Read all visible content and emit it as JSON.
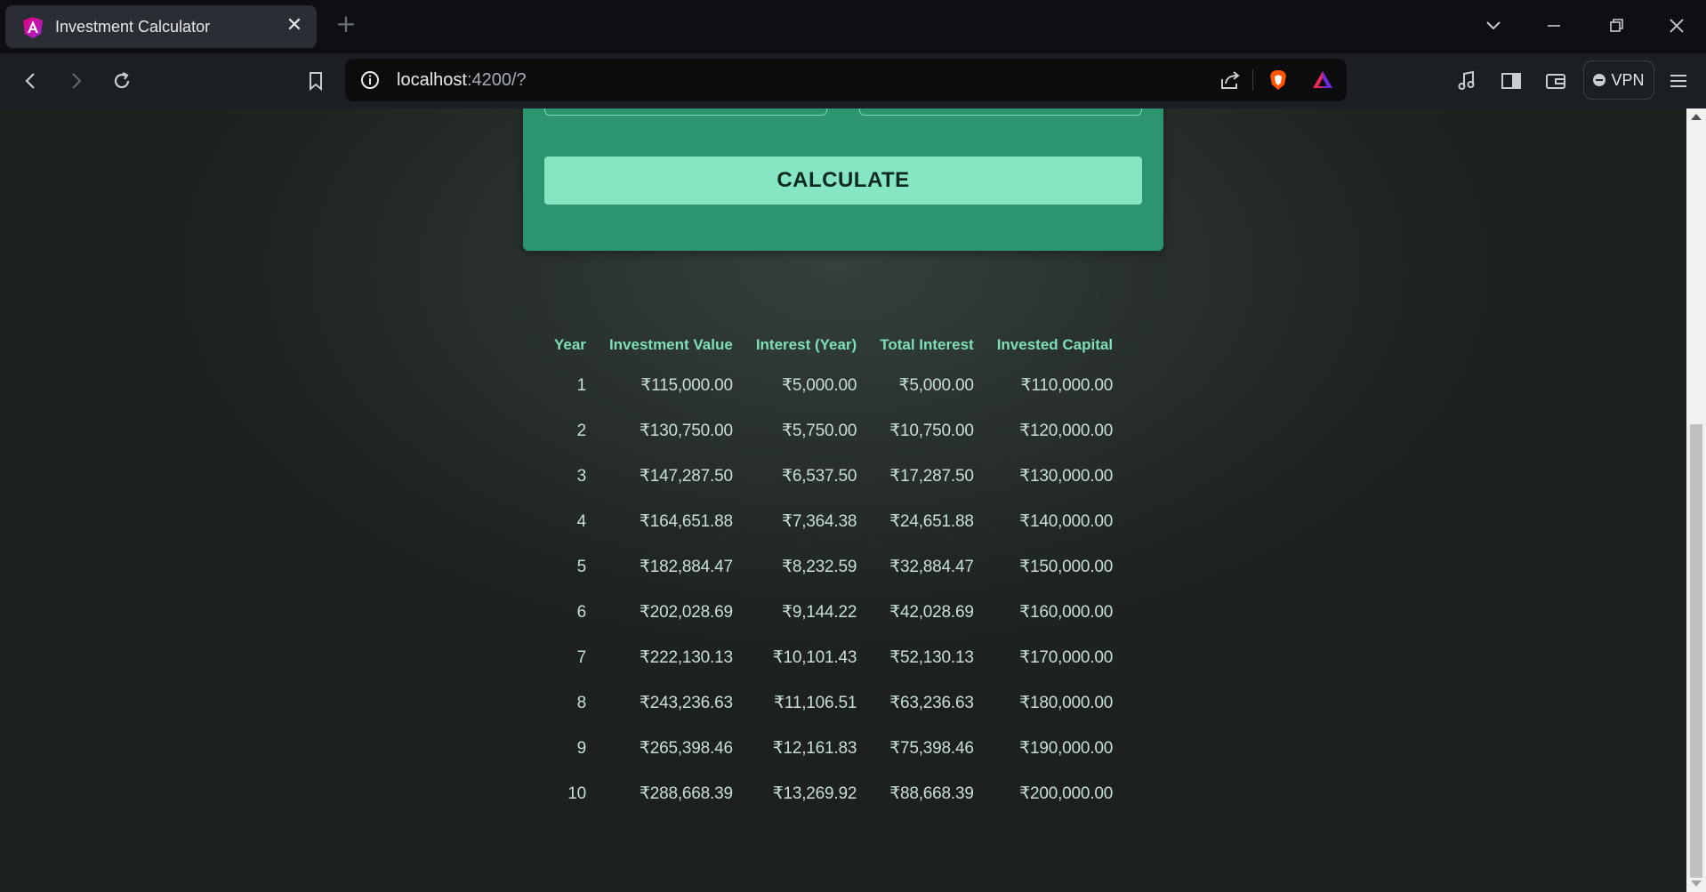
{
  "browser": {
    "tab": {
      "title": "Investment Calculator",
      "close_glyph": "✕"
    },
    "new_tab_glyph": "+",
    "window_controls": {
      "tabs_menu": "⌄",
      "minimize": "—",
      "restore": "❐",
      "close": "✕"
    },
    "toolbar": {
      "back": "‹",
      "forward": "›",
      "reload": "↻",
      "bookmark": "🔖",
      "url_host": "localhost",
      "url_path": ":4200/?",
      "vpn_label": "VPN"
    },
    "colors": {
      "accent": "#2d9470",
      "button": "#86e6c1",
      "header_text": "#7fe0b7"
    }
  },
  "form": {
    "calculate_label": "CALCULATE"
  },
  "results": {
    "headers": [
      "Year",
      "Investment Value",
      "Interest (Year)",
      "Total Interest",
      "Invested Capital"
    ],
    "rows": [
      [
        "1",
        "₹115,000.00",
        "₹5,000.00",
        "₹5,000.00",
        "₹110,000.00"
      ],
      [
        "2",
        "₹130,750.00",
        "₹5,750.00",
        "₹10,750.00",
        "₹120,000.00"
      ],
      [
        "3",
        "₹147,287.50",
        "₹6,537.50",
        "₹17,287.50",
        "₹130,000.00"
      ],
      [
        "4",
        "₹164,651.88",
        "₹7,364.38",
        "₹24,651.88",
        "₹140,000.00"
      ],
      [
        "5",
        "₹182,884.47",
        "₹8,232.59",
        "₹32,884.47",
        "₹150,000.00"
      ],
      [
        "6",
        "₹202,028.69",
        "₹9,144.22",
        "₹42,028.69",
        "₹160,000.00"
      ],
      [
        "7",
        "₹222,130.13",
        "₹10,101.43",
        "₹52,130.13",
        "₹170,000.00"
      ],
      [
        "8",
        "₹243,236.63",
        "₹11,106.51",
        "₹63,236.63",
        "₹180,000.00"
      ],
      [
        "9",
        "₹265,398.46",
        "₹12,161.83",
        "₹75,398.46",
        "₹190,000.00"
      ],
      [
        "10",
        "₹288,668.39",
        "₹13,269.92",
        "₹88,668.39",
        "₹200,000.00"
      ]
    ]
  }
}
